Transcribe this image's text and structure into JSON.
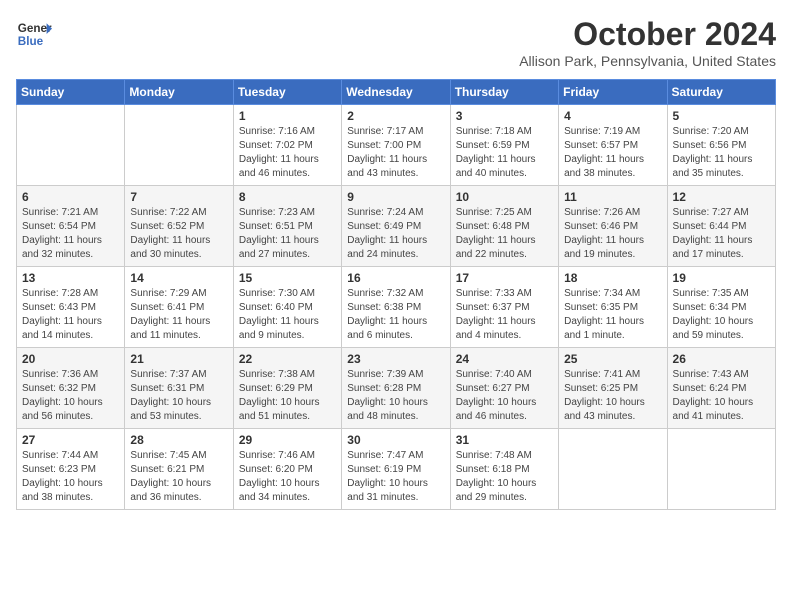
{
  "header": {
    "logo_line1": "General",
    "logo_line2": "Blue",
    "month": "October 2024",
    "location": "Allison Park, Pennsylvania, United States"
  },
  "days_of_week": [
    "Sunday",
    "Monday",
    "Tuesday",
    "Wednesday",
    "Thursday",
    "Friday",
    "Saturday"
  ],
  "weeks": [
    [
      {
        "day": "",
        "detail": ""
      },
      {
        "day": "",
        "detail": ""
      },
      {
        "day": "1",
        "detail": "Sunrise: 7:16 AM\nSunset: 7:02 PM\nDaylight: 11 hours\nand 46 minutes."
      },
      {
        "day": "2",
        "detail": "Sunrise: 7:17 AM\nSunset: 7:00 PM\nDaylight: 11 hours\nand 43 minutes."
      },
      {
        "day": "3",
        "detail": "Sunrise: 7:18 AM\nSunset: 6:59 PM\nDaylight: 11 hours\nand 40 minutes."
      },
      {
        "day": "4",
        "detail": "Sunrise: 7:19 AM\nSunset: 6:57 PM\nDaylight: 11 hours\nand 38 minutes."
      },
      {
        "day": "5",
        "detail": "Sunrise: 7:20 AM\nSunset: 6:56 PM\nDaylight: 11 hours\nand 35 minutes."
      }
    ],
    [
      {
        "day": "6",
        "detail": "Sunrise: 7:21 AM\nSunset: 6:54 PM\nDaylight: 11 hours\nand 32 minutes."
      },
      {
        "day": "7",
        "detail": "Sunrise: 7:22 AM\nSunset: 6:52 PM\nDaylight: 11 hours\nand 30 minutes."
      },
      {
        "day": "8",
        "detail": "Sunrise: 7:23 AM\nSunset: 6:51 PM\nDaylight: 11 hours\nand 27 minutes."
      },
      {
        "day": "9",
        "detail": "Sunrise: 7:24 AM\nSunset: 6:49 PM\nDaylight: 11 hours\nand 24 minutes."
      },
      {
        "day": "10",
        "detail": "Sunrise: 7:25 AM\nSunset: 6:48 PM\nDaylight: 11 hours\nand 22 minutes."
      },
      {
        "day": "11",
        "detail": "Sunrise: 7:26 AM\nSunset: 6:46 PM\nDaylight: 11 hours\nand 19 minutes."
      },
      {
        "day": "12",
        "detail": "Sunrise: 7:27 AM\nSunset: 6:44 PM\nDaylight: 11 hours\nand 17 minutes."
      }
    ],
    [
      {
        "day": "13",
        "detail": "Sunrise: 7:28 AM\nSunset: 6:43 PM\nDaylight: 11 hours\nand 14 minutes."
      },
      {
        "day": "14",
        "detail": "Sunrise: 7:29 AM\nSunset: 6:41 PM\nDaylight: 11 hours\nand 11 minutes."
      },
      {
        "day": "15",
        "detail": "Sunrise: 7:30 AM\nSunset: 6:40 PM\nDaylight: 11 hours\nand 9 minutes."
      },
      {
        "day": "16",
        "detail": "Sunrise: 7:32 AM\nSunset: 6:38 PM\nDaylight: 11 hours\nand 6 minutes."
      },
      {
        "day": "17",
        "detail": "Sunrise: 7:33 AM\nSunset: 6:37 PM\nDaylight: 11 hours\nand 4 minutes."
      },
      {
        "day": "18",
        "detail": "Sunrise: 7:34 AM\nSunset: 6:35 PM\nDaylight: 11 hours\nand 1 minute."
      },
      {
        "day": "19",
        "detail": "Sunrise: 7:35 AM\nSunset: 6:34 PM\nDaylight: 10 hours\nand 59 minutes."
      }
    ],
    [
      {
        "day": "20",
        "detail": "Sunrise: 7:36 AM\nSunset: 6:32 PM\nDaylight: 10 hours\nand 56 minutes."
      },
      {
        "day": "21",
        "detail": "Sunrise: 7:37 AM\nSunset: 6:31 PM\nDaylight: 10 hours\nand 53 minutes."
      },
      {
        "day": "22",
        "detail": "Sunrise: 7:38 AM\nSunset: 6:29 PM\nDaylight: 10 hours\nand 51 minutes."
      },
      {
        "day": "23",
        "detail": "Sunrise: 7:39 AM\nSunset: 6:28 PM\nDaylight: 10 hours\nand 48 minutes."
      },
      {
        "day": "24",
        "detail": "Sunrise: 7:40 AM\nSunset: 6:27 PM\nDaylight: 10 hours\nand 46 minutes."
      },
      {
        "day": "25",
        "detail": "Sunrise: 7:41 AM\nSunset: 6:25 PM\nDaylight: 10 hours\nand 43 minutes."
      },
      {
        "day": "26",
        "detail": "Sunrise: 7:43 AM\nSunset: 6:24 PM\nDaylight: 10 hours\nand 41 minutes."
      }
    ],
    [
      {
        "day": "27",
        "detail": "Sunrise: 7:44 AM\nSunset: 6:23 PM\nDaylight: 10 hours\nand 38 minutes."
      },
      {
        "day": "28",
        "detail": "Sunrise: 7:45 AM\nSunset: 6:21 PM\nDaylight: 10 hours\nand 36 minutes."
      },
      {
        "day": "29",
        "detail": "Sunrise: 7:46 AM\nSunset: 6:20 PM\nDaylight: 10 hours\nand 34 minutes."
      },
      {
        "day": "30",
        "detail": "Sunrise: 7:47 AM\nSunset: 6:19 PM\nDaylight: 10 hours\nand 31 minutes."
      },
      {
        "day": "31",
        "detail": "Sunrise: 7:48 AM\nSunset: 6:18 PM\nDaylight: 10 hours\nand 29 minutes."
      },
      {
        "day": "",
        "detail": ""
      },
      {
        "day": "",
        "detail": ""
      }
    ]
  ]
}
